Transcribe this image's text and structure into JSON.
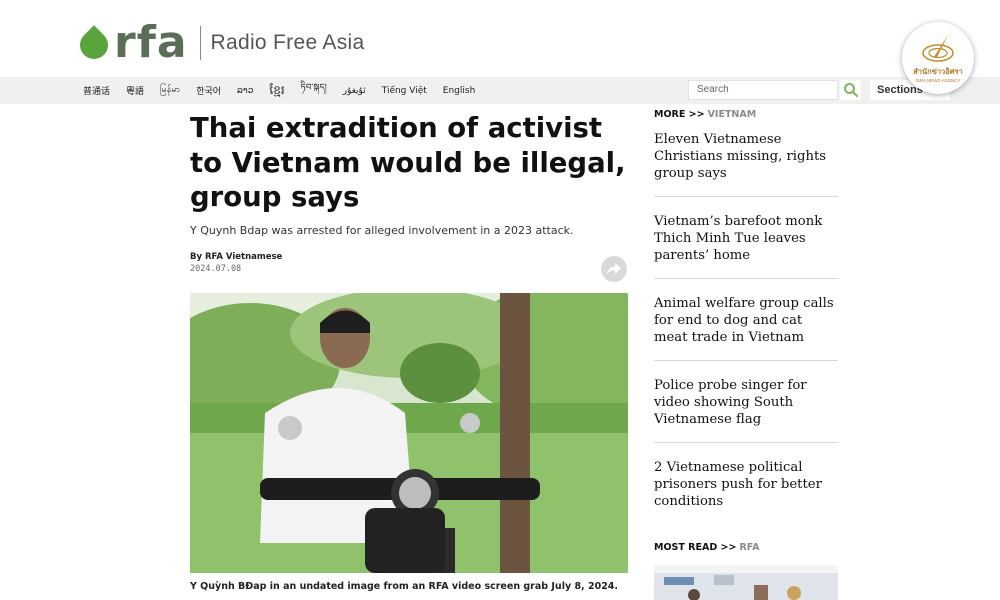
{
  "brand": {
    "logo_text": "rfa",
    "name": "Radio Free Asia",
    "logo_color": "#5aa43c"
  },
  "languages": [
    {
      "label": "普通话"
    },
    {
      "label": "粵語"
    },
    {
      "label": "မြန်မာ"
    },
    {
      "label": "한국어"
    },
    {
      "label": "ລາວ"
    },
    {
      "label": "ខ្មែរ"
    },
    {
      "label": "ཏིབ་སྐད།"
    },
    {
      "label": "ئۇيغۇر"
    },
    {
      "label": "Tiếng Việt"
    },
    {
      "label": "English"
    }
  ],
  "search": {
    "placeholder": "Search",
    "icon": "search-icon"
  },
  "sections_label": "Sections",
  "badge": {
    "name": "สำนักข่าวอิศรา",
    "sub": "ISRA NEWS AGENCY"
  },
  "article": {
    "headline": "Thai extradition of activist to Vietnam would be illegal, group says",
    "dek": "Y Quynh Bdap was arrested for alleged involvement in a 2023 attack.",
    "byline": "By RFA Vietnamese",
    "date": "2024.07.08",
    "caption": "Y Quỳnh BĐap in an undated image from an RFA video screen grab July 8, 2024."
  },
  "sidebar": {
    "more_label": "MORE >>",
    "more_category": "VIETNAM",
    "items": [
      {
        "title": "Eleven Vietnamese Christians missing, rights group says"
      },
      {
        "title": "Vietnam’s barefoot monk Thich Minh Tue leaves parents’ home"
      },
      {
        "title": "Animal welfare group calls for end to dog and cat meat trade in Vietnam"
      },
      {
        "title": "Police probe singer for video showing South Vietnamese flag"
      },
      {
        "title": "2 Vietnamese political prisoners push for better conditions"
      }
    ],
    "most_label": "MOST READ >>",
    "most_category": "RFA"
  }
}
